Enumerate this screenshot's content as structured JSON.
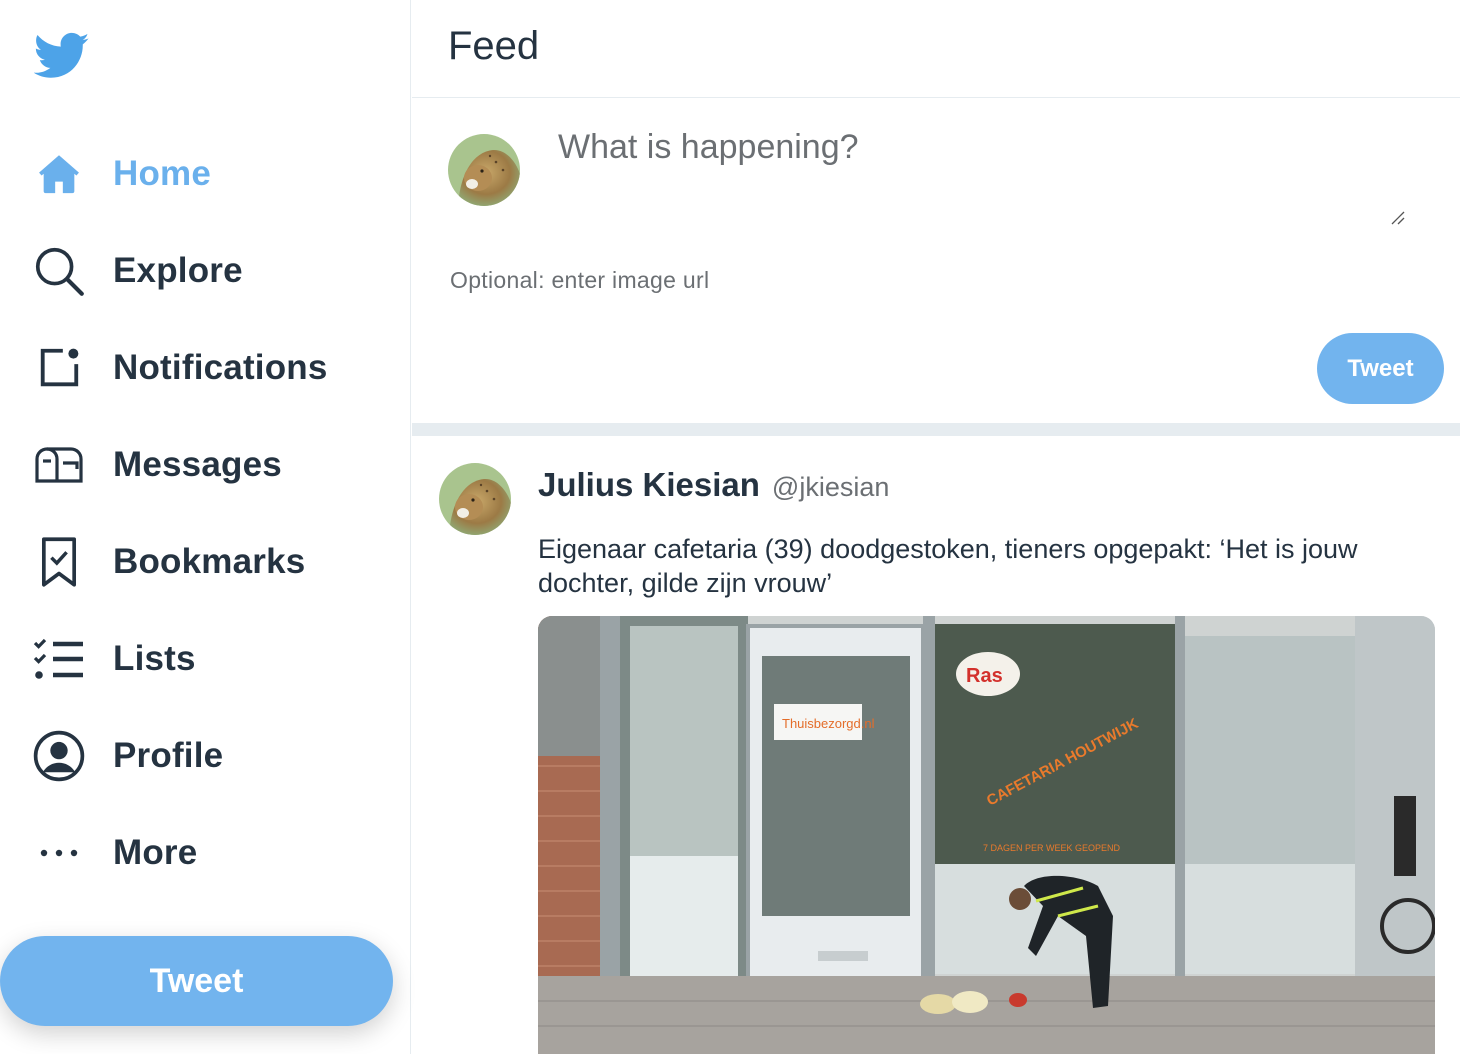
{
  "sidebar": {
    "logo_icon": "twitter-bird-icon",
    "items": [
      {
        "label": "Home",
        "icon": "home-icon",
        "active": true
      },
      {
        "label": "Explore",
        "icon": "search-icon",
        "active": false
      },
      {
        "label": "Notifications",
        "icon": "notifications-icon",
        "active": false
      },
      {
        "label": "Messages",
        "icon": "mailbox-icon",
        "active": false
      },
      {
        "label": "Bookmarks",
        "icon": "bookmark-icon",
        "active": false
      },
      {
        "label": "Lists",
        "icon": "list-icon",
        "active": false
      },
      {
        "label": "Profile",
        "icon": "profile-icon",
        "active": false
      },
      {
        "label": "More",
        "icon": "more-icon",
        "active": false
      }
    ],
    "tweet_button": "Tweet"
  },
  "feed": {
    "title": "Feed"
  },
  "composer": {
    "placeholder": "What is happening?",
    "image_url_placeholder": "Optional: enter image url",
    "tweet_button": "Tweet"
  },
  "tweets": [
    {
      "name": "Julius Kiesian",
      "handle": "@jkiesian",
      "text": "Eigenaar cafetaria (39) doodgestoken, tieners opgepakt: ‘Het is jouw dochter, gilde zijn vrouw’",
      "image_signs": [
        "Thuisbezorgd.nl",
        "Ras",
        "CAFETARIA HOUTWIJK",
        "7 DAGEN PER WEEK GEOPEND"
      ]
    }
  ],
  "colors": {
    "accent": "#6ab0ec",
    "button": "#72b4ee",
    "text_dark": "#253341",
    "text_muted": "#6b6f73",
    "border": "#e6ecf0"
  }
}
